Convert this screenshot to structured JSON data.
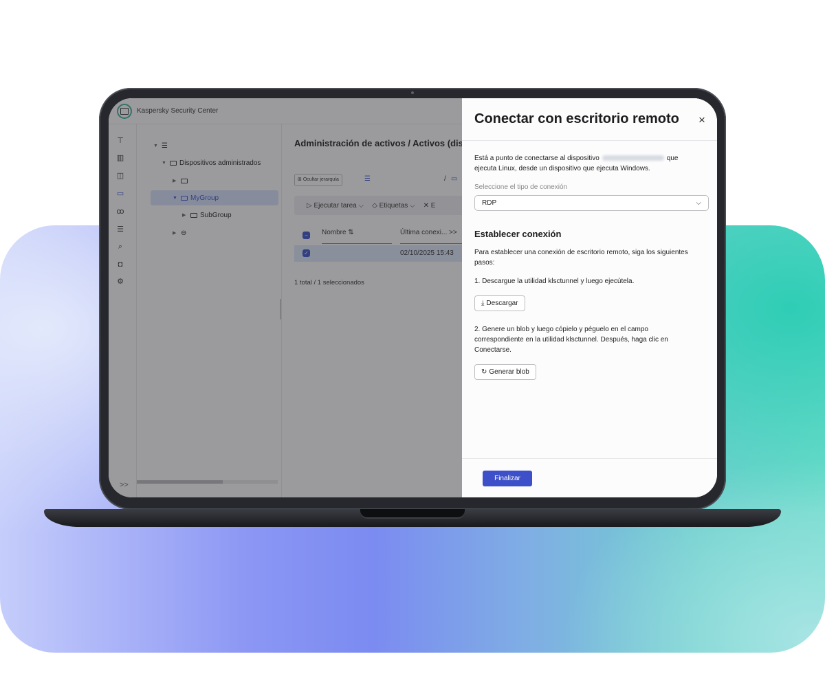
{
  "app": {
    "title": "Kaspersky Security Center"
  },
  "tree": {
    "managed_devices": "Dispositivos administrados",
    "mygroup": "MyGroup",
    "subgroup": "SubGroup"
  },
  "main": {
    "title": "Administración de activos / Activos (dis",
    "hide_hierarchy": "Ocultar jerarquía",
    "path_sep": "/",
    "run_task": "▷ Ejecutar tarea ⌵",
    "tags": "◇ Etiquetas ⌵",
    "delete_partial": "✕ E",
    "col_name": "Nombre ⇅",
    "col_last_conn": "Última conexi... >>",
    "row_date": "02/10/2025 15:43",
    "total": "1 total / 1 seleccionados"
  },
  "dialog": {
    "title": "Conectar con escritorio remoto",
    "close_icon": "×",
    "intro_before": "Está a punto de conectarse al dispositivo",
    "intro_after": "que ejecuta Linux, desde un dispositivo que ejecuta Windows.",
    "conn_type_label": "Seleccione el tipo de conexión",
    "conn_type_value": "RDP",
    "section_title": "Establecer conexión",
    "steps_intro": "Para establecer una conexión de escritorio remoto, siga los siguientes pasos:",
    "step1": "1. Descargue la utilidad klsctunnel y luego ejecútela.",
    "download_label": "Descargar",
    "step2": "2. Genere un blob y luego cópielo y péguelo en el campo correspondiente en la utilidad klsctunnel. Después, haga clic en Conectarse.",
    "generate_blob_label": "Generar blob",
    "finish_label": "Finalizar"
  },
  "colors": {
    "accent": "#3d4fc9",
    "brand_green": "#3cb39a",
    "backdrop_teal": "#2fcdb5",
    "backdrop_blue": "#7b8bf1"
  },
  "icons": {
    "rail": [
      "monitoring-icon",
      "map-icon",
      "dashboard-icon",
      "devices-icon",
      "users-icon",
      "servers-icon",
      "search-icon",
      "store-icon",
      "settings-icon"
    ],
    "expand_more": ">>"
  }
}
